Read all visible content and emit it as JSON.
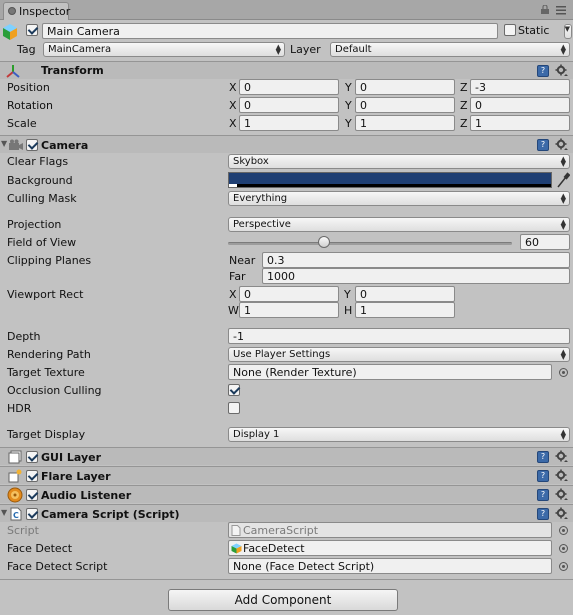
{
  "window": {
    "tab_label": "Inspector"
  },
  "header": {
    "object_name": "Main Camera",
    "static_label": "Static",
    "tag_label": "Tag",
    "tag_value": "MainCamera",
    "layer_label": "Layer",
    "layer_value": "Default"
  },
  "transform": {
    "title": "Transform",
    "position_label": "Position",
    "rotation_label": "Rotation",
    "scale_label": "Scale",
    "position": {
      "x": "0",
      "y": "0",
      "z": "-3"
    },
    "rotation": {
      "x": "0",
      "y": "0",
      "z": "0"
    },
    "scale": {
      "x": "1",
      "y": "1",
      "z": "1"
    },
    "axis": {
      "x": "X",
      "y": "Y",
      "z": "Z"
    }
  },
  "camera": {
    "title": "Camera",
    "clear_flags_label": "Clear Flags",
    "clear_flags_value": "Skybox",
    "background_label": "Background",
    "background_color": "#1f3f73",
    "culling_mask_label": "Culling Mask",
    "culling_mask_value": "Everything",
    "projection_label": "Projection",
    "projection_value": "Perspective",
    "fov_label": "Field of View",
    "fov_value": "60",
    "clipping_label": "Clipping Planes",
    "near_label": "Near",
    "near_value": "0.3",
    "far_label": "Far",
    "far_value": "1000",
    "viewport_label": "Viewport Rect",
    "viewport": {
      "x": "0",
      "y": "0",
      "w": "1",
      "h": "1"
    },
    "viewport_axis": {
      "x": "X",
      "y": "Y",
      "w": "W",
      "h": "H"
    },
    "depth_label": "Depth",
    "depth_value": "-1",
    "rendering_path_label": "Rendering Path",
    "rendering_path_value": "Use Player Settings",
    "target_texture_label": "Target Texture",
    "target_texture_value": "None (Render Texture)",
    "occlusion_label": "Occlusion Culling",
    "hdr_label": "HDR",
    "target_display_label": "Target Display",
    "target_display_value": "Display 1"
  },
  "gui_layer": {
    "title": "GUI Layer"
  },
  "flare_layer": {
    "title": "Flare Layer"
  },
  "audio_listener": {
    "title": "Audio Listener"
  },
  "camera_script": {
    "title": "Camera Script (Script)",
    "script_label": "Script",
    "script_value": "CameraScript",
    "face_detect_label": "Face Detect",
    "face_detect_value": "FaceDetect",
    "face_detect_script_label": "Face Detect Script",
    "face_detect_script_value": "None (Face Detect Script)"
  },
  "add_component_label": "Add Component",
  "icons": {
    "help": "?",
    "accent": "#3c6aa8"
  }
}
